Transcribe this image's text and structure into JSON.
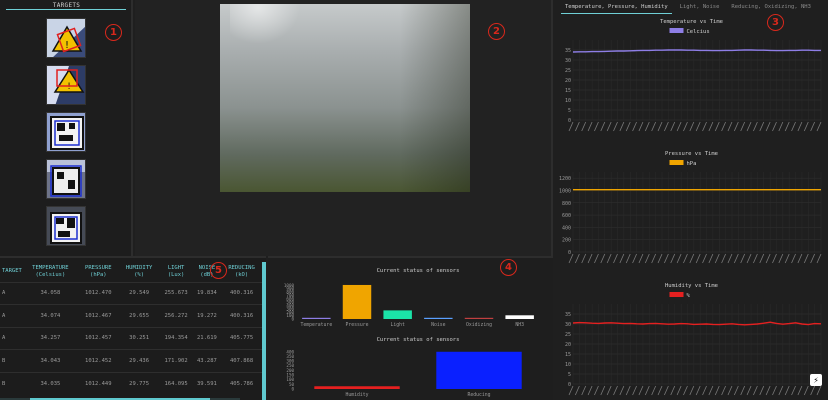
{
  "targets": {
    "title": "TARGETS"
  },
  "badges": [
    "1",
    "2",
    "3",
    "4",
    "5"
  ],
  "tabs": [
    "Temperature, Pressure, Humidity",
    "Light, Noise",
    "Reducing, Oxidizing, NH3"
  ],
  "charts": [
    {
      "title": "Temperature vs Time",
      "legend": "Celcius",
      "color": "#8e7ee6",
      "y_ticks": [
        "0",
        "5",
        "10",
        "15",
        "20",
        "25",
        "30",
        "35"
      ],
      "y_max": 40,
      "values": [
        34.0,
        34.1,
        34.1,
        34.2,
        34.2,
        34.3,
        34.4,
        34.5,
        34.5,
        34.6,
        34.7,
        34.8,
        34.8,
        34.9,
        34.9,
        35.0,
        35.0,
        35.0,
        34.9,
        34.9,
        34.8,
        34.8,
        34.7,
        34.7,
        34.8,
        34.8,
        34.9,
        35.0,
        35.0,
        34.9,
        34.9,
        34.8,
        34.7,
        34.7,
        34.8,
        34.8,
        34.9,
        34.9,
        34.8,
        34.8
      ]
    },
    {
      "title": "Pressure vs Time",
      "legend": "hPa",
      "color": "#f0a500",
      "y_ticks": [
        "0",
        "200",
        "400",
        "600",
        "800",
        "1000",
        "1200"
      ],
      "y_max": 1300,
      "values": [
        1012,
        1012,
        1012,
        1012,
        1012,
        1012,
        1012,
        1012,
        1012,
        1012,
        1012,
        1012,
        1012,
        1012,
        1012,
        1012,
        1012,
        1012,
        1012,
        1012,
        1012,
        1012,
        1012,
        1012,
        1012,
        1012,
        1012,
        1012,
        1012,
        1012,
        1012,
        1012,
        1012,
        1012,
        1012,
        1012,
        1012,
        1012,
        1012,
        1012
      ]
    },
    {
      "title": "Humidity vs Time",
      "legend": "%",
      "color": "#e52020",
      "y_ticks": [
        "0",
        "5",
        "10",
        "15",
        "20",
        "25",
        "30",
        "35"
      ],
      "y_max": 40,
      "values": [
        30.5,
        30.7,
        30.6,
        30.4,
        30.3,
        30.5,
        30.6,
        30.4,
        30.2,
        30.3,
        30.1,
        30.0,
        30.2,
        30.3,
        30.1,
        29.9,
        30.0,
        30.2,
        30.1,
        29.8,
        29.9,
        30.0,
        29.8,
        29.7,
        29.9,
        30.1,
        29.8,
        29.6,
        29.8,
        30.0,
        30.4,
        30.9,
        30.3,
        29.9,
        30.2,
        30.6,
        30.0,
        29.7,
        30.2,
        30.1
      ]
    }
  ],
  "table": {
    "headers": [
      [
        "TARGET",
        ""
      ],
      [
        "TEMPERATURE",
        "(Celsius)"
      ],
      [
        "PRESSURE",
        "(hPa)"
      ],
      [
        "HUMIDITY",
        "(%)"
      ],
      [
        "LIGHT",
        "(Lux)"
      ],
      [
        "NOISE",
        "(dB)"
      ],
      [
        "REDUCING",
        "(kO)"
      ]
    ],
    "rows": [
      [
        "A",
        "34.058",
        "1012.470",
        "29.549",
        "255.673",
        "19.834",
        "400.316"
      ],
      [
        "A",
        "34.074",
        "1012.467",
        "29.655",
        "256.272",
        "19.272",
        "400.316"
      ],
      [
        "A",
        "34.257",
        "1012.457",
        "30.251",
        "194.354",
        "21.619",
        "405.775"
      ],
      [
        "B",
        "34.043",
        "1012.452",
        "29.436",
        "171.902",
        "43.287",
        "407.868"
      ],
      [
        "B",
        "34.035",
        "1012.449",
        "29.775",
        "164.095",
        "39.591",
        "405.786"
      ]
    ]
  },
  "status_top": {
    "title": "Current status of sensors",
    "y_ticks": [
      "0",
      "100",
      "200",
      "300",
      "400",
      "500",
      "600",
      "700",
      "800",
      "900",
      "1000"
    ],
    "y_max": 1100,
    "categories": [
      "Temperature",
      "Pressure",
      "Light",
      "Noise",
      "Oxidizing",
      "NH3"
    ],
    "values": [
      34,
      1012,
      256,
      20,
      2,
      110
    ],
    "colors": [
      "#8e7ee6",
      "#f0a500",
      "#1be3a8",
      "#5aa0ff",
      "#c04040",
      "#ffffff"
    ]
  },
  "status_bottom": {
    "title": "Current status of sensors",
    "y_ticks": [
      "0",
      "50",
      "100",
      "150",
      "200",
      "250",
      "300",
      "350",
      "400"
    ],
    "y_max": 430,
    "categories": [
      "Humidity",
      "Reducing"
    ],
    "values": [
      29.5,
      400.3
    ],
    "colors": [
      "#e52020",
      "#0a20ff"
    ]
  },
  "toggle_icon": "bolt-icon"
}
